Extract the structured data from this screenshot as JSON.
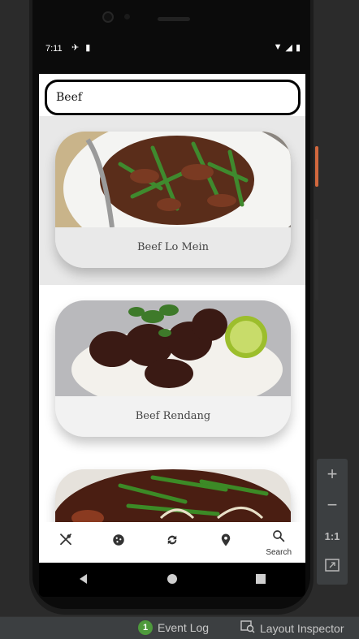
{
  "status_bar": {
    "time": "7:11"
  },
  "search": {
    "value": "Beef",
    "placeholder": ""
  },
  "recipes": [
    {
      "title": "Beef Lo Mein"
    },
    {
      "title": "Beef Rendang"
    },
    {
      "title": ""
    }
  ],
  "bottom_nav": {
    "items": [
      {
        "icon": "utensils-icon",
        "label": ""
      },
      {
        "icon": "cookie-icon",
        "label": ""
      },
      {
        "icon": "refresh-icon",
        "label": ""
      },
      {
        "icon": "location-pin-icon",
        "label": ""
      },
      {
        "icon": "search-icon",
        "label": "Search"
      }
    ]
  },
  "tool_panel": {
    "zoom_in": "+",
    "zoom_out": "−",
    "actual_size": "1:1"
  },
  "ide_bar": {
    "event_log_count": "1",
    "event_log": "Event Log",
    "layout_inspector": "Layout Inspector"
  },
  "colors": {
    "accent_power": "#d2683e",
    "event_badge": "#4e9a3c"
  }
}
